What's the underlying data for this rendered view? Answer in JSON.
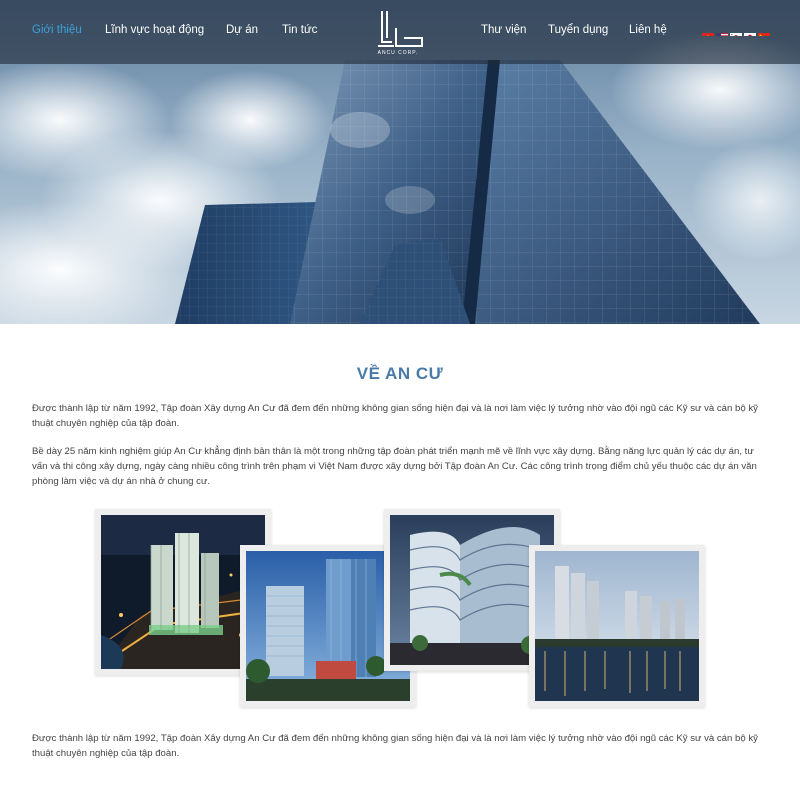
{
  "nav": {
    "left_items": [
      {
        "label": "Giới thiệu",
        "active": true
      },
      {
        "label": "Lĩnh vực hoạt động",
        "active": false
      },
      {
        "label": "Dự án",
        "active": false
      },
      {
        "label": "Tin tức",
        "active": false
      }
    ],
    "right_items": [
      {
        "label": "Thư viện"
      },
      {
        "label": "Tuyển dụng"
      },
      {
        "label": "Liên hệ"
      }
    ],
    "logo_text": "ANCU CORP.",
    "languages": [
      "vietnam-flag-icon",
      "usa-flag-icon",
      "korea-flag-icon",
      "japan-flag-icon",
      "china-flag-icon"
    ],
    "active_color": "#3ea0d8"
  },
  "about": {
    "title": "VỀ AN CƯ",
    "paragraph1": "Được thành lập từ năm 1992, Tập đoàn Xây dựng An Cư đã đem đến những không gian sống hiện đại và là nơi làm việc lý tưởng nhờ vào đội ngũ các Kỹ sư và cán bộ kỹ thuật chuyên nghiệp của tập đoàn.",
    "paragraph2": "Bề dày 25 năm kinh nghiệm giúp An Cư khẳng định bản thân là một trong những tập đoàn phát triển mạnh mẽ về lĩnh vực xây dựng. Bằng năng lực quản lý các dự án, tư vấn và thi công xây dựng, ngày càng nhiều công trình trên phạm vi Việt Nam được xây dựng bởi Tập đoàn An Cư. Các công trình trọng điểm chủ yếu thuộc các dự án văn phòng làm việc và dự án nhà ở chung  cư.",
    "paragraph3": "Được thành lập từ năm 1992, Tập đoàn Xây dựng An Cư đã đem đến những không gian sống hiện đại và là nơi làm việc lý tưởng nhờ vào đội ngũ các Kỹ sư và cán bộ kỹ thuật chuyên nghiệp của tập đoàn.",
    "title_color": "#4a7ba8"
  },
  "gallery": [
    "night-towers-photo",
    "office-tower-photo",
    "curved-building-photo",
    "waterfront-skyline-photo"
  ]
}
